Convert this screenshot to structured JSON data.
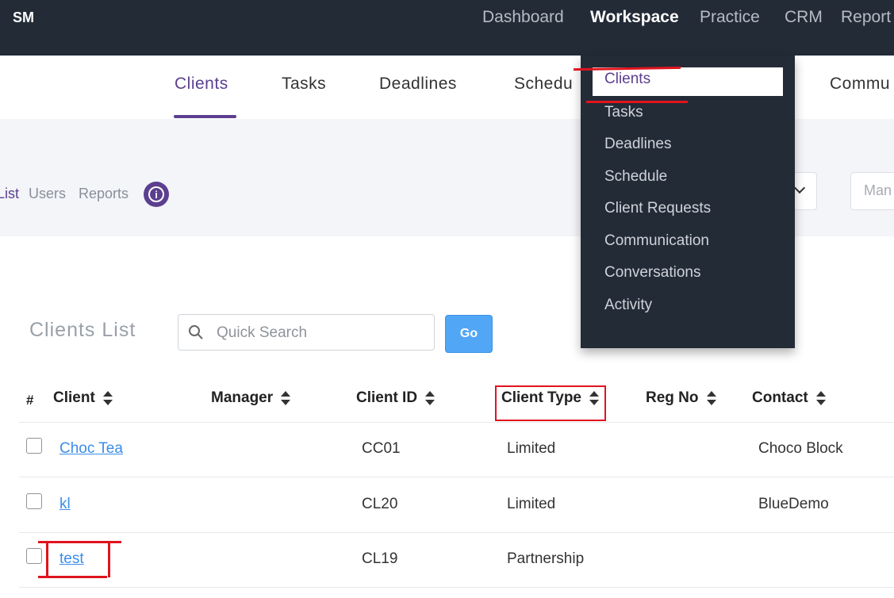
{
  "app": {
    "brand": "SM"
  },
  "topnav": {
    "items": [
      {
        "label": "Dashboard"
      },
      {
        "label": "Workspace"
      },
      {
        "label": "Practice"
      },
      {
        "label": "CRM"
      },
      {
        "label": "Report"
      }
    ],
    "active": "Workspace"
  },
  "subnav": {
    "tabs": [
      {
        "label": "Clients"
      },
      {
        "label": "Tasks"
      },
      {
        "label": "Deadlines"
      },
      {
        "label": "Schedu"
      },
      {
        "label": "Commu"
      }
    ],
    "active": "Clients"
  },
  "toolbar": {
    "links": [
      {
        "label": "List"
      },
      {
        "label": "Users"
      },
      {
        "label": "Reports"
      }
    ],
    "info_icon": "info-icon",
    "manager_placeholder": "Man"
  },
  "workspace_menu": {
    "items": [
      {
        "label": "Clients"
      },
      {
        "label": "Tasks"
      },
      {
        "label": "Deadlines"
      },
      {
        "label": "Schedule"
      },
      {
        "label": "Client Requests"
      },
      {
        "label": "Communication"
      },
      {
        "label": "Conversations"
      },
      {
        "label": "Activity"
      }
    ],
    "active": "Clients"
  },
  "clients_list": {
    "title": "Clients List",
    "search_placeholder": "Quick Search",
    "go_label": "Go",
    "columns": [
      "#",
      "Client",
      "Manager",
      "Client ID",
      "Client Type",
      "Reg No",
      "Contact"
    ],
    "rows": [
      {
        "client": "Choc Tea",
        "manager": "",
        "client_id": "CC01",
        "client_type": "Limited",
        "reg_no": "",
        "contact": "Choco Block"
      },
      {
        "client": "kl",
        "manager": "",
        "client_id": "CL20",
        "client_type": "Limited",
        "reg_no": "",
        "contact": "BlueDemo"
      },
      {
        "client": "test",
        "manager": "",
        "client_id": "CL19",
        "client_type": "Partnership",
        "reg_no": "",
        "contact": ""
      }
    ]
  },
  "colors": {
    "nav_bg": "#232b37",
    "accent_purple": "#5c3f8f",
    "link_blue": "#3b8de8",
    "go_blue": "#51a6f5",
    "annotation_red": "#e0141e",
    "band_bg": "#f3f5f9"
  }
}
